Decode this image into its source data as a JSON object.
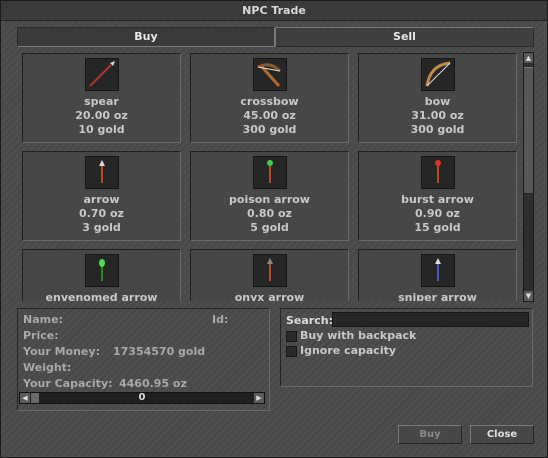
{
  "window": {
    "title": "NPC Trade"
  },
  "tabs": [
    {
      "label": "Buy",
      "active": true
    },
    {
      "label": "Sell",
      "active": false
    }
  ],
  "items": [
    {
      "name": "spear",
      "weight": "20.00 oz",
      "price": "10 gold",
      "icon": "spear-icon"
    },
    {
      "name": "crossbow",
      "weight": "45.00 oz",
      "price": "300 gold",
      "icon": "crossbow-icon"
    },
    {
      "name": "bow",
      "weight": "31.00 oz",
      "price": "300 gold",
      "icon": "bow-icon"
    },
    {
      "name": "arrow",
      "weight": "0.70 oz",
      "price": "3 gold",
      "icon": "arrow-icon"
    },
    {
      "name": "poison arrow",
      "weight": "0.80 oz",
      "price": "5 gold",
      "icon": "poison-arrow-icon"
    },
    {
      "name": "burst arrow",
      "weight": "0.90 oz",
      "price": "15 gold",
      "icon": "burst-arrow-icon"
    },
    {
      "name": "envenomed arrow",
      "icon": "envenomed-arrow-icon"
    },
    {
      "name": "onyx arrow",
      "icon": "onyx-arrow-icon"
    },
    {
      "name": "sniper arrow",
      "icon": "sniper-arrow-icon"
    }
  ],
  "details": {
    "name_label": "Name:",
    "id_label": "Id:",
    "price_label": "Price:",
    "money_label": "Your Money:",
    "money_value": "17354570 gold",
    "weight_label": "Weight:",
    "capacity_label": "Your Capacity:",
    "capacity_value": "4460.95 oz"
  },
  "amount": {
    "value": "0"
  },
  "options": {
    "search_label": "Search:",
    "search_value": "",
    "buy_with_backpack": "Buy with backpack",
    "ignore_capacity": "Ignore capacity"
  },
  "buttons": {
    "buy": "Buy",
    "close": "Close"
  },
  "colors": {
    "window_bg": "#4b4b4b",
    "text": "#c8c8c8",
    "label": "#a9a9a9",
    "disabled_text": "#8a8a8a"
  }
}
